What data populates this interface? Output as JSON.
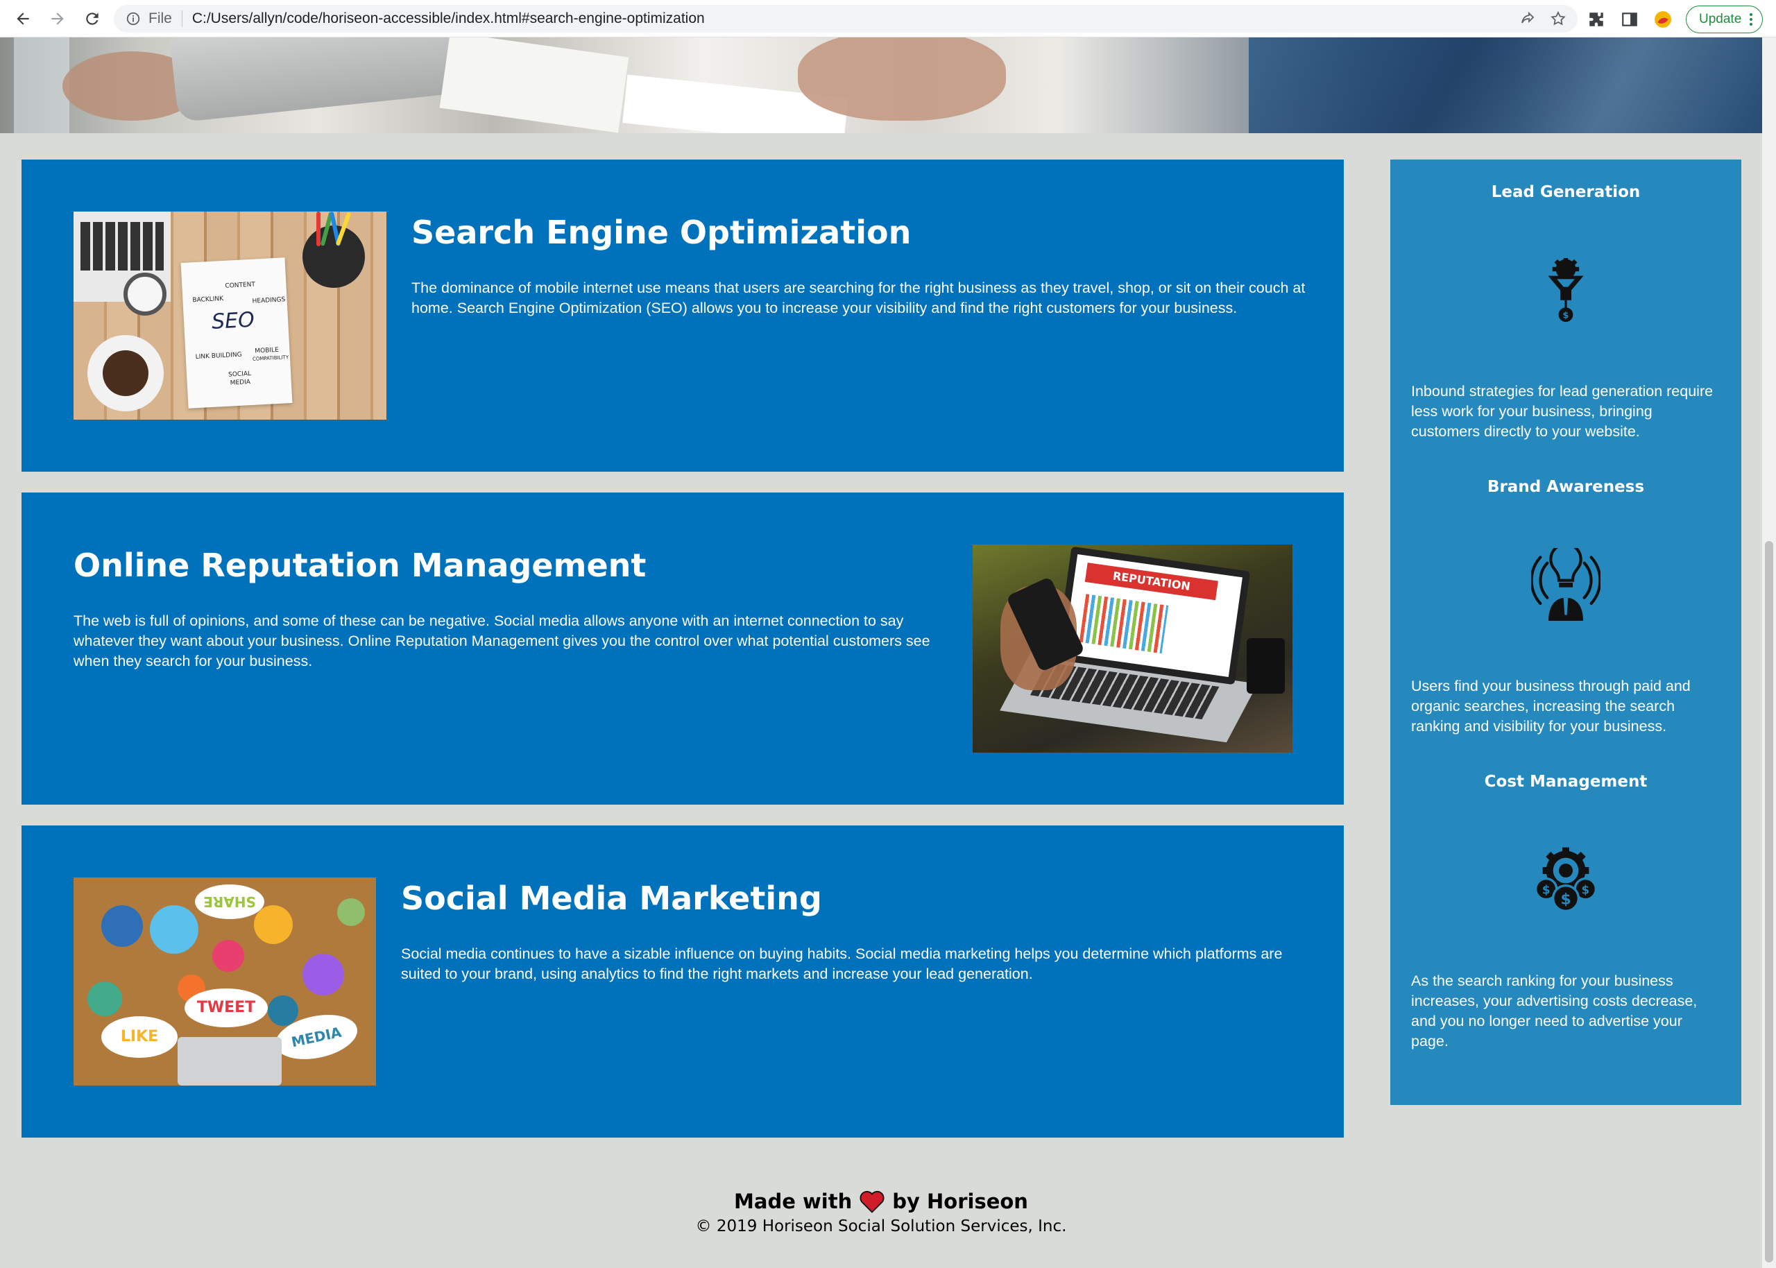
{
  "browser": {
    "file_label": "File",
    "url": "C:/Users/allyn/code/horiseon-accessible/index.html#search-engine-optimization",
    "update_label": "Update"
  },
  "sections": [
    {
      "title": "Search Engine Optimization",
      "text": "The dominance of mobile internet use means that users are searching for the right business as they travel, shop, or sit on their couch at home. Search Engine Optimization (SEO) allows you to increase your visibility and find the right customers for your business.",
      "image_words": {
        "seo": "SEO",
        "content": "CONTENT",
        "backlink": "BACKLINK",
        "headings": "HEADINGS",
        "link_building": "LINK BUILDING",
        "mobile": "MOBILE",
        "compatibility": "COMPATIBILITY",
        "social": "SOCIAL",
        "media": "MEDIA"
      }
    },
    {
      "title": "Online Reputation Management",
      "text": "The web is full of opinions, and some of these can be negative. Social media allows anyone with an internet connection to say whatever they want about your business. Online Reputation Management gives you the control over what potential customers see when they search for your business.",
      "image_words": {
        "banner": "REPUTATION"
      }
    },
    {
      "title": "Social Media Marketing",
      "text": "Social media continues to have a sizable influence on buying habits. Social media marketing helps you determine which platforms are suited to your brand, using analytics to find the right markets and increase your lead generation.",
      "image_words": {
        "share": "SHARE",
        "tweet": "TWEET",
        "like": "LIKE",
        "media": "MEDIA"
      }
    }
  ],
  "benefits": [
    {
      "title": "Lead Generation",
      "icon": "lead-generation-funnel-icon",
      "text": "Inbound strategies for lead generation require less work for your business, bringing customers directly to your website."
    },
    {
      "title": "Brand Awareness",
      "icon": "brand-awareness-lightbulb-icon",
      "text": "Users find your business through paid and organic searches, increasing the search ranking and visibility for your business."
    },
    {
      "title": "Cost Management",
      "icon": "cost-management-gear-coins-icon",
      "text": "As the search ranking for your business increases, your advertising costs decrease, and you no longer need to advertise your page."
    }
  ],
  "footer": {
    "made_with": "Made with",
    "by": "by Horiseon",
    "copyright": "© 2019 Horiseon Social Solution Services, Inc."
  },
  "colors": {
    "card_blue": "#0072bb",
    "sidebar_blue": "#2589bd",
    "page_background": "#d9dbd8",
    "heart": "#d11c2a"
  }
}
